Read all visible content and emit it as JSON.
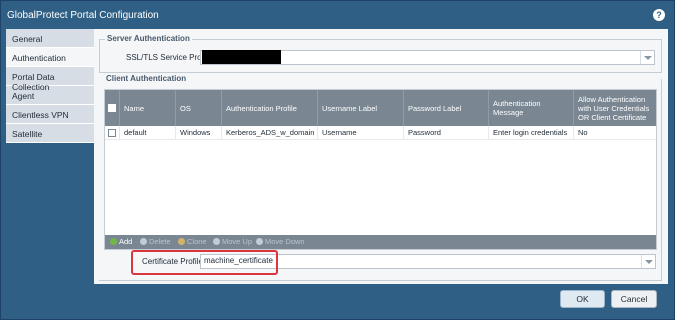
{
  "window": {
    "title": "GlobalProtect Portal Configuration",
    "help_icon": "help-icon",
    "help_glyph": "?"
  },
  "sidebar": {
    "tabs": [
      {
        "label": "General"
      },
      {
        "label": "Authentication",
        "active": true
      },
      {
        "label": "Portal Data Collection"
      },
      {
        "label": "Agent"
      },
      {
        "label": "Clientless VPN"
      },
      {
        "label": "Satellite"
      }
    ]
  },
  "server_auth": {
    "legend": "Server Authentication",
    "ssl_label": "SSL/TLS Service Profile",
    "ssl_value": ""
  },
  "client_auth": {
    "legend": "Client Authentication",
    "columns": [
      "Name",
      "OS",
      "Authentication Profile",
      "Username Label",
      "Password Label",
      "Authentication Message",
      "Allow Authentication with User Credentials OR Client Certificate"
    ],
    "rows": [
      {
        "name": "default",
        "os": "Windows",
        "auth_profile": "Kerberos_ADS_w_domain",
        "username_label": "Username",
        "password_label": "Password",
        "auth_message": "Enter login credentials",
        "allow": "No"
      }
    ],
    "toolbar": {
      "add": "Add",
      "delete": "Delete",
      "clone": "Clone",
      "move_up": "Move Up",
      "move_down": "Move Down"
    }
  },
  "certificate": {
    "label": "Certificate Profile",
    "value": "machine_certificate"
  },
  "footer": {
    "ok": "OK",
    "cancel": "Cancel"
  },
  "colors": {
    "title_bar": "#2f5f84",
    "grid_header": "#7a8793",
    "highlight": "#d9363e",
    "add_icon": "#74b64a"
  }
}
